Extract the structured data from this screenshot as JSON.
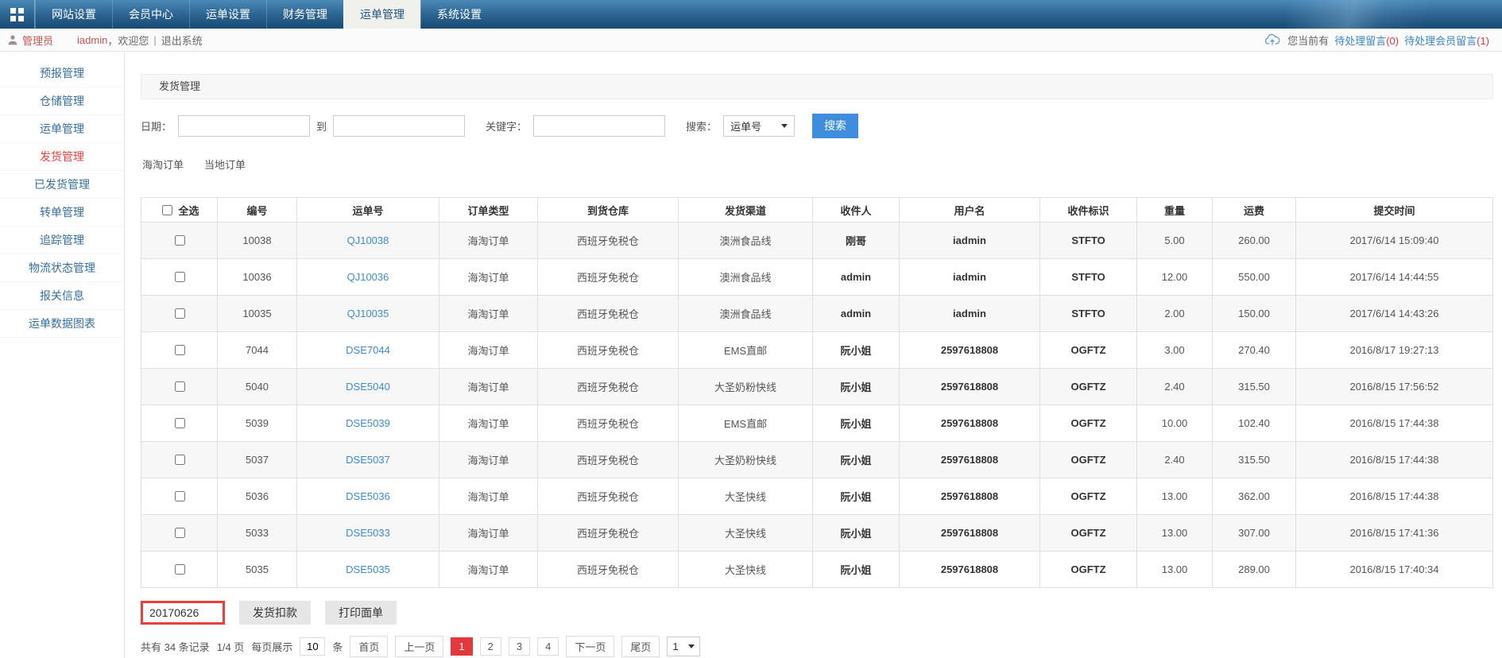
{
  "colors": {
    "accent": "#3e8edd",
    "danger": "#e4393c",
    "link": "#3c8cd4",
    "nav_top": "#4b89b7",
    "nav_bottom": "#174a74",
    "sidebar_link": "#33709f"
  },
  "nav": {
    "tabs": [
      "网站设置",
      "会员中心",
      "运单设置",
      "财务管理",
      "运单管理",
      "系统设置"
    ],
    "active_index": 4
  },
  "userbar": {
    "role": "管理员",
    "username": "iadmin",
    "welcome": "，欢迎您",
    "separator": "|",
    "logout": "退出系统",
    "pending_prefix": "您当前有",
    "pending_messages_label": "待处理留言",
    "pending_messages_count": "(0)",
    "pending_member_messages_label": "待处理会员留言",
    "pending_member_messages_count": "(1)"
  },
  "sidebar": {
    "items": [
      "预报管理",
      "仓储管理",
      "运单管理",
      "发货管理",
      "已发货管理",
      "转单管理",
      "追踪管理",
      "物流状态管理",
      "报关信息",
      "运单数据图表"
    ],
    "active_index": 3
  },
  "panel": {
    "title": "发货管理"
  },
  "search": {
    "date_label": "日期：",
    "to_label": "到",
    "keyword_label": "关键字：",
    "search_label": "搜索：",
    "select_value": "运单号",
    "button": "搜索"
  },
  "order_tabs": [
    "海淘订单",
    "当地订单"
  ],
  "table": {
    "select_all": "全选",
    "headers": [
      "编号",
      "运单号",
      "订单类型",
      "到货仓库",
      "发货渠道",
      "收件人",
      "用户名",
      "收件标识",
      "重量",
      "运费",
      "提交时间"
    ],
    "rows": [
      {
        "id": "10038",
        "waybill": "QJ10038",
        "type": "海淘订单",
        "warehouse": "西班牙免税仓",
        "channel": "澳洲食品线",
        "receiver": "刚哥",
        "user": "iadmin",
        "tag": "STFTO",
        "weight": "5.00",
        "fee": "260.00",
        "time": "2017/6/14 15:09:40"
      },
      {
        "id": "10036",
        "waybill": "QJ10036",
        "type": "海淘订单",
        "warehouse": "西班牙免税仓",
        "channel": "澳洲食品线",
        "receiver": "admin",
        "user": "iadmin",
        "tag": "STFTO",
        "weight": "12.00",
        "fee": "550.00",
        "time": "2017/6/14 14:44:55"
      },
      {
        "id": "10035",
        "waybill": "QJ10035",
        "type": "海淘订单",
        "warehouse": "西班牙免税仓",
        "channel": "澳洲食品线",
        "receiver": "admin",
        "user": "iadmin",
        "tag": "STFTO",
        "weight": "2.00",
        "fee": "150.00",
        "time": "2017/6/14 14:43:26"
      },
      {
        "id": "7044",
        "waybill": "DSE7044",
        "type": "海淘订单",
        "warehouse": "西班牙免税仓",
        "channel": "EMS直邮",
        "receiver": "阮小姐",
        "user": "2597618808",
        "tag": "OGFTZ",
        "weight": "3.00",
        "fee": "270.40",
        "time": "2016/8/17 19:27:13"
      },
      {
        "id": "5040",
        "waybill": "DSE5040",
        "type": "海淘订单",
        "warehouse": "西班牙免税仓",
        "channel": "大圣奶粉快线",
        "receiver": "阮小姐",
        "user": "2597618808",
        "tag": "OGFTZ",
        "weight": "2.40",
        "fee": "315.50",
        "time": "2016/8/15 17:56:52"
      },
      {
        "id": "5039",
        "waybill": "DSE5039",
        "type": "海淘订单",
        "warehouse": "西班牙免税仓",
        "channel": "EMS直邮",
        "receiver": "阮小姐",
        "user": "2597618808",
        "tag": "OGFTZ",
        "weight": "10.00",
        "fee": "102.40",
        "time": "2016/8/15 17:44:38"
      },
      {
        "id": "5037",
        "waybill": "DSE5037",
        "type": "海淘订单",
        "warehouse": "西班牙免税仓",
        "channel": "大圣奶粉快线",
        "receiver": "阮小姐",
        "user": "2597618808",
        "tag": "OGFTZ",
        "weight": "2.40",
        "fee": "315.50",
        "time": "2016/8/15 17:44:38"
      },
      {
        "id": "5036",
        "waybill": "DSE5036",
        "type": "海淘订单",
        "warehouse": "西班牙免税仓",
        "channel": "大圣快线",
        "receiver": "阮小姐",
        "user": "2597618808",
        "tag": "OGFTZ",
        "weight": "13.00",
        "fee": "362.00",
        "time": "2016/8/15 17:44:38"
      },
      {
        "id": "5033",
        "waybill": "DSE5033",
        "type": "海淘订单",
        "warehouse": "西班牙免税仓",
        "channel": "大圣快线",
        "receiver": "阮小姐",
        "user": "2597618808",
        "tag": "OGFTZ",
        "weight": "13.00",
        "fee": "307.00",
        "time": "2016/8/15 17:41:36"
      },
      {
        "id": "5035",
        "waybill": "DSE5035",
        "type": "海淘订单",
        "warehouse": "西班牙免税仓",
        "channel": "大圣快线",
        "receiver": "阮小姐",
        "user": "2597618808",
        "tag": "OGFTZ",
        "weight": "13.00",
        "fee": "289.00",
        "time": "2016/8/15 17:40:34"
      }
    ]
  },
  "actions": {
    "batch_no": "20170626",
    "deduct": "发货扣款",
    "print": "打印面单"
  },
  "pagination": {
    "total_text": "共有 34 条记录",
    "page_text": "1/4 页",
    "per_page_label": "每页展示",
    "per_page": "10",
    "unit": "条",
    "first": "首页",
    "prev": "上一页",
    "pages": [
      "1",
      "2",
      "3",
      "4"
    ],
    "current": "1",
    "next": "下一页",
    "last": "尾页",
    "jump": "1"
  }
}
